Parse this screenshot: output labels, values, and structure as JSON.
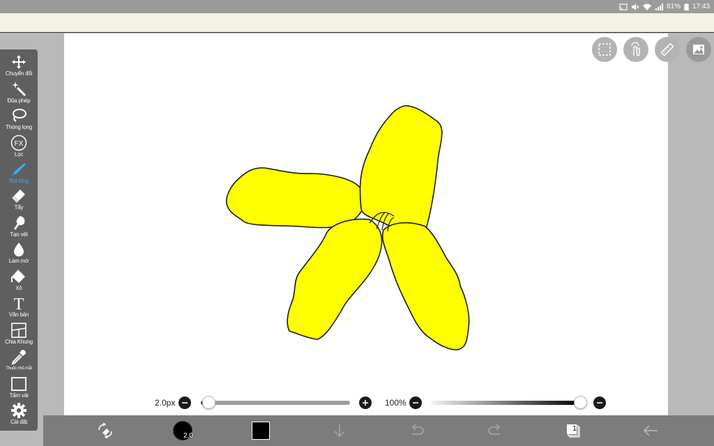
{
  "status_bar": {
    "battery": "81%",
    "time": "17:43",
    "icons": [
      "cast-icon",
      "mute-icon",
      "wifi-icon",
      "signal-icon",
      "battery-icon"
    ]
  },
  "tools": [
    {
      "id": "move",
      "label": "Chuyển đổi",
      "icon": "move-icon",
      "active": false
    },
    {
      "id": "magic-wand",
      "label": "Đũa phép",
      "icon": "magic-wand-icon",
      "active": false
    },
    {
      "id": "lasso",
      "label": "Thòng lọng",
      "icon": "lasso-icon",
      "active": false
    },
    {
      "id": "filter",
      "label": "Lọc",
      "icon": "fx-icon",
      "active": false
    },
    {
      "id": "brush",
      "label": "Bút lông",
      "icon": "brush-icon",
      "active": true
    },
    {
      "id": "eraser",
      "label": "Tẩy",
      "icon": "eraser-icon",
      "active": false
    },
    {
      "id": "smudge",
      "label": "Tạo vết",
      "icon": "smudge-icon",
      "active": false
    },
    {
      "id": "blur",
      "label": "Làm mờ",
      "icon": "drop-icon",
      "active": false
    },
    {
      "id": "fill",
      "label": "Xô",
      "icon": "bucket-icon",
      "active": false
    },
    {
      "id": "text",
      "label": "Văn bản",
      "icon": "text-icon",
      "active": false
    },
    {
      "id": "frame",
      "label": "Chia Khung",
      "icon": "frame-divider-icon",
      "active": false
    },
    {
      "id": "eyedropper",
      "label": "Thuốc nhỏ mắt",
      "icon": "eyedropper-icon",
      "active": false
    },
    {
      "id": "canvas",
      "label": "Tấm vải",
      "icon": "canvas-icon",
      "active": false
    },
    {
      "id": "settings",
      "label": "Cài đặt",
      "icon": "gear-icon",
      "active": false
    }
  ],
  "top_tools": [
    "selection-icon",
    "touch-icon",
    "ruler-icon",
    "image-icon"
  ],
  "brush_size": {
    "label": "2.0px",
    "value": 2.0,
    "fraction": 0.05
  },
  "opacity": {
    "label": "100%",
    "value": 100,
    "fraction": 1.0
  },
  "bottom_bar": {
    "brush_preview_label": "2.0",
    "layer_count": "1",
    "color": "#000000",
    "icons": [
      "transform-eraser-icon",
      "brush-size-icon",
      "color-swatch-icon",
      "download-icon",
      "undo-icon",
      "redo-icon",
      "layers-icon",
      "back-icon"
    ]
  },
  "colors": {
    "accent": "#3fa9f5",
    "flower_fill": "#ffff00",
    "toolbar": "#5f5f5f"
  }
}
